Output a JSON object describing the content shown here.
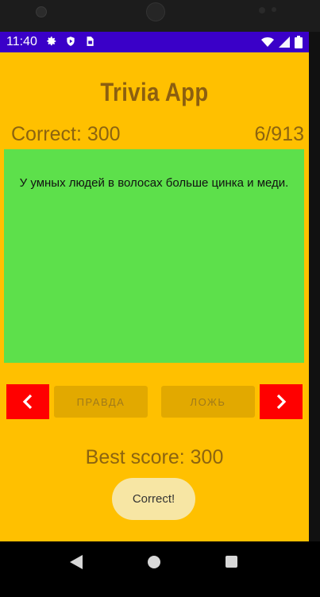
{
  "status_bar": {
    "time": "11:40",
    "left_icons": [
      "gear-icon",
      "shield-icon",
      "sim-icon"
    ],
    "right_icons": [
      "wifi-icon",
      "cell-signal-icon",
      "battery-icon"
    ]
  },
  "app": {
    "title": "Trivia App",
    "correct_label": "Correct: 300",
    "counter": "6/913",
    "question": "У умных людей в волосах больше цинка и меди.",
    "true_label": "ПРАВДА",
    "false_label": "ЛОЖЬ",
    "best_score": "Best score: 300",
    "toast": "Correct!"
  },
  "colors": {
    "background": "#ffc000",
    "card": "#5de04b",
    "nav_buttons": "#ff0000",
    "answer_buttons": "#e2a900",
    "status_bar": "#3a00c8"
  }
}
